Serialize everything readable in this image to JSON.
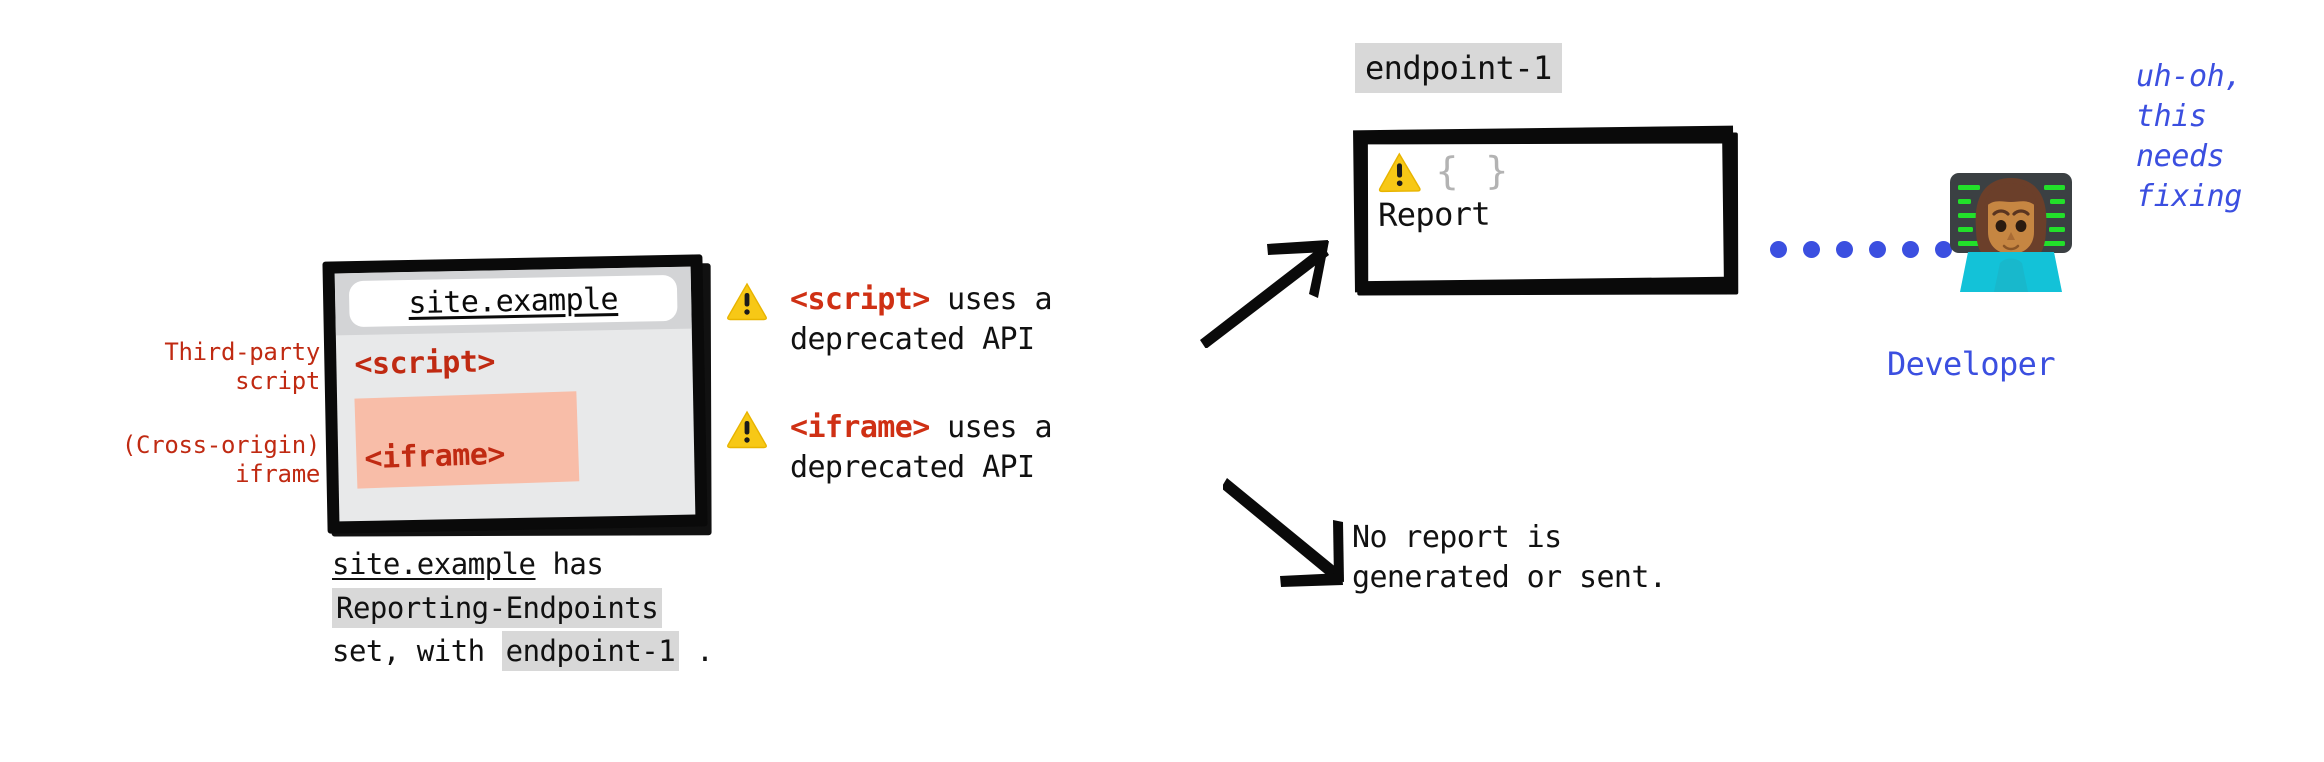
{
  "diagram": {
    "title": "Reporting endpoints: third-party script and cross-origin iframe reporting behaviour"
  },
  "colors": {
    "accent_red": "#c02a12",
    "tag_red": "#cf3014",
    "developer_blue": "#3b4fe0",
    "warning_yellow": "#f7c816",
    "iframe_highlight": "#f8bda8",
    "code_chip_gray": "#d8d8d8",
    "frame_black": "#0a0a0a",
    "page_gray": "#e8e9ea",
    "toolbar_gray": "#d3d4d6",
    "braces_gray": "#b3b3b3"
  },
  "side_labels": [
    {
      "line1": "Third-party",
      "line2": "script"
    },
    {
      "line1": "(Cross-origin)",
      "line2": "iframe"
    }
  ],
  "browser": {
    "url": "site.example",
    "content": {
      "script_tag": "<script>",
      "iframe_tag": "<iframe>"
    }
  },
  "browser_caption": {
    "site": "site.example",
    "has": " has",
    "header_name": "Reporting-Endpoints",
    "set_with": "set, with",
    "endpoint": "endpoint-1",
    "period": "."
  },
  "warnings": [
    {
      "icon": "warning-triangle-icon",
      "tag": "<script>",
      "rest": " uses a",
      "line2": "deprecated API"
    },
    {
      "icon": "warning-triangle-icon",
      "tag": "<iframe>",
      "rest": " uses a",
      "line2": "deprecated API"
    }
  ],
  "endpoint_chip": {
    "label": "endpoint-1"
  },
  "report_box": {
    "icon": "warning-triangle-icon",
    "braces": "{ }",
    "label": "Report"
  },
  "no_report_note": {
    "line1": "No report is",
    "line2": "generated or sent."
  },
  "connector": {
    "icon": "dotted-line-icon",
    "dot_count": 6
  },
  "developer": {
    "icon": "woman-technologist-emoji",
    "label": "Developer",
    "speech": {
      "line1": "uh-oh,",
      "line2": "this",
      "line3": "needs",
      "line4": "fixing"
    }
  },
  "arrows": {
    "to_report": "arrow-up-right-icon",
    "to_no_report": "arrow-down-right-icon"
  }
}
